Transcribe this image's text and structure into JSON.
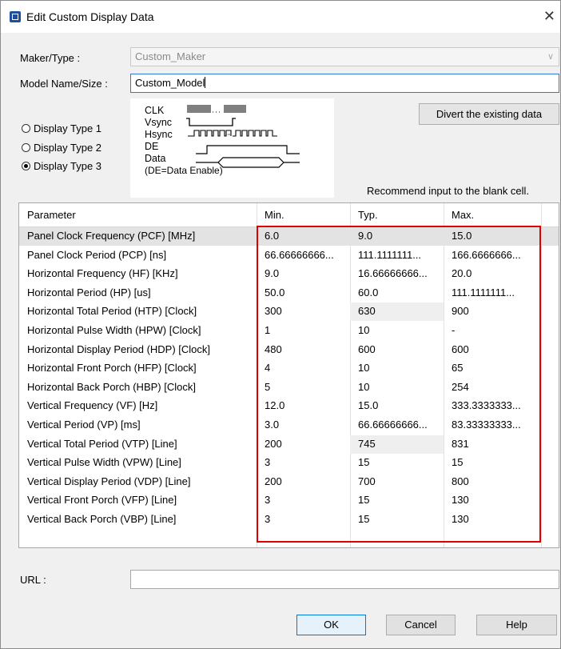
{
  "window": {
    "title": "Edit Custom Display Data",
    "close_glyph": "✕"
  },
  "form": {
    "maker_label": "Maker/Type :",
    "maker_value": "Custom_Maker",
    "model_label": "Model Name/Size :",
    "model_value": "Custom_Model",
    "display_types": [
      {
        "label": "Display Type 1",
        "selected": false
      },
      {
        "label": "Display Type 2",
        "selected": false
      },
      {
        "label": "Display Type 3",
        "selected": true
      }
    ],
    "divert_button": "Divert the existing data",
    "recommend_text": "Recommend input to the blank cell.",
    "url_label": "URL :",
    "url_value": ""
  },
  "timing_diagram": {
    "labels": [
      "CLK",
      "Vsync",
      "Hsync",
      "DE",
      "Data"
    ],
    "note": "(DE=Data Enable)"
  },
  "table": {
    "columns": [
      "Parameter",
      "Min.",
      "Typ.",
      "Max."
    ],
    "rows": [
      [
        "Panel Clock Frequency (PCF) [MHz]",
        "6.0",
        "9.0",
        "15.0"
      ],
      [
        "Panel Clock Period (PCP) [ns]",
        "66.66666666...",
        "111.1111111...",
        "166.6666666..."
      ],
      [
        "Horizontal Frequency (HF) [KHz]",
        "9.0",
        "16.66666666...",
        "20.0"
      ],
      [
        "Horizontal Period (HP) [us]",
        "50.0",
        "60.0",
        "111.1111111..."
      ],
      [
        "Horizontal Total Period (HTP) [Clock]",
        "300",
        "630",
        "900"
      ],
      [
        "Horizontal Pulse Width (HPW) [Clock]",
        "1",
        "10",
        "-"
      ],
      [
        "Horizontal Display Period (HDP) [Clock]",
        "480",
        "600",
        "600"
      ],
      [
        "Horizontal Front Porch (HFP) [Clock]",
        "4",
        "10",
        "65"
      ],
      [
        "Horizontal Back Porch (HBP) [Clock]",
        "5",
        "10",
        "254"
      ],
      [
        "Vertical Frequency (VF) [Hz]",
        "12.0",
        "15.0",
        "333.3333333..."
      ],
      [
        "Vertical Period (VP) [ms]",
        "3.0",
        "66.66666666...",
        "83.33333333..."
      ],
      [
        "Vertical Total Period (VTP) [Line]",
        "200",
        "745",
        "831"
      ],
      [
        "Vertical Pulse Width (VPW) [Line]",
        "3",
        "15",
        "15"
      ],
      [
        "Vertical Display Period (VDP) [Line]",
        "200",
        "700",
        "800"
      ],
      [
        "Vertical Front Porch (VFP) [Line]",
        "3",
        "15",
        "130"
      ],
      [
        "Vertical Back Porch (VBP) [Line]",
        "3",
        "15",
        "130"
      ]
    ]
  },
  "buttons": {
    "ok": "OK",
    "cancel": "Cancel",
    "help": "Help"
  }
}
